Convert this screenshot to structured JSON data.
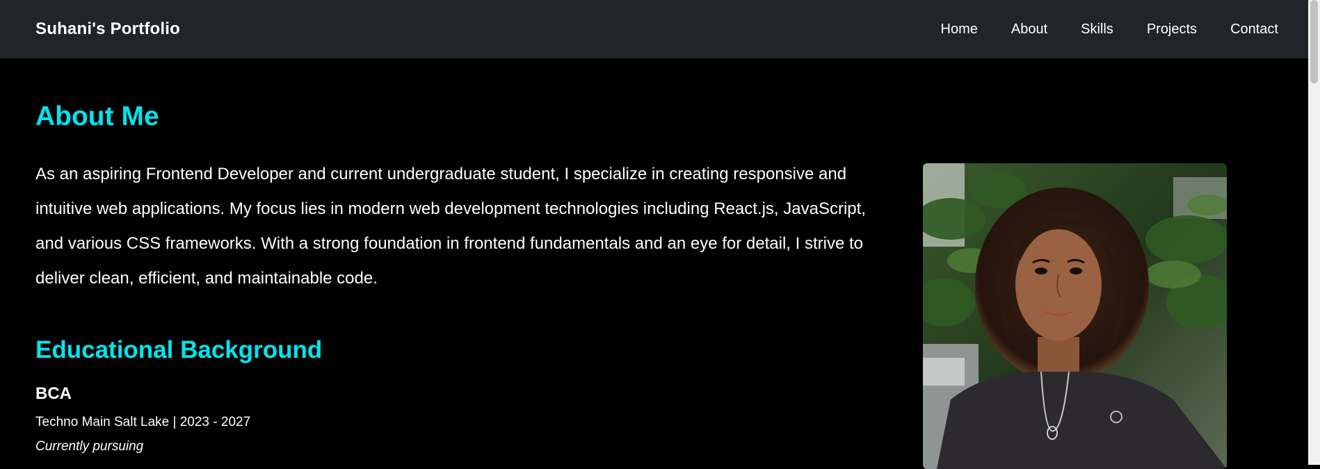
{
  "navbar": {
    "brand": "Suhani's Portfolio",
    "links": [
      "Home",
      "About",
      "Skills",
      "Projects",
      "Contact"
    ]
  },
  "about": {
    "title": "About Me",
    "paragraph": "As an aspiring Frontend Developer and current undergraduate student, I specialize in creating responsive and intuitive web applications. My focus lies in modern web development technologies including React.js, JavaScript, and various CSS frameworks. With a strong foundation in frontend fundamentals and an eye for detail, I strive to deliver clean, efficient, and maintainable code."
  },
  "education": {
    "title": "Educational Background",
    "degree": "BCA",
    "school": "Techno Main Salt Lake | 2023 - 2027",
    "status": "Currently pursuing"
  },
  "colors": {
    "accent": "#00e5ee",
    "navbar_bg": "#212529",
    "page_bg": "#000000"
  },
  "profile_photo": {
    "icon": "profile-photo-image"
  }
}
